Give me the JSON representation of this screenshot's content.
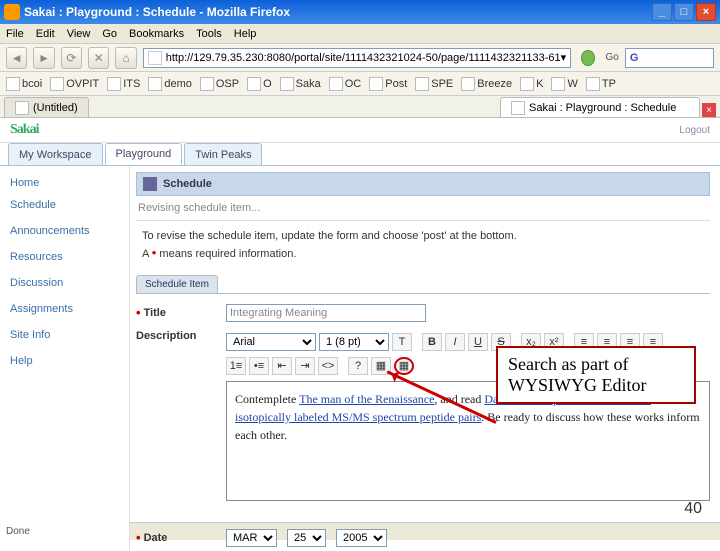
{
  "window": {
    "title": "Sakai : Playground : Schedule - Mozilla Firefox",
    "min": "_",
    "max": "□",
    "close": "×"
  },
  "menu": {
    "file": "File",
    "edit": "Edit",
    "view": "View",
    "go": "Go",
    "bookmarks": "Bookmarks",
    "tools": "Tools",
    "help": "Help"
  },
  "url": "http://129.79.35.230:8080/portal/site/1111432321024-50/page/1111432321133-61",
  "go_label": "Go",
  "search_engine": "G",
  "bookmarks": [
    {
      "label": "bcoi"
    },
    {
      "label": "OVPIT"
    },
    {
      "label": "ITS"
    },
    {
      "label": "demo"
    },
    {
      "label": "OSP"
    },
    {
      "label": "O"
    },
    {
      "label": "Saka"
    },
    {
      "label": "OC"
    },
    {
      "label": "Post"
    },
    {
      "label": "SPE"
    },
    {
      "label": "Breeze"
    },
    {
      "label": "K"
    },
    {
      "label": "W"
    },
    {
      "label": "TP"
    }
  ],
  "tabs": [
    {
      "label": "(Untitled)"
    },
    {
      "label": "Sakai : Playground : Schedule",
      "active": true
    }
  ],
  "site_logo": "Sakai",
  "logout": "Logout",
  "workspace_tabs": [
    {
      "label": "My Workspace"
    },
    {
      "label": "Playground",
      "active": true
    },
    {
      "label": "Twin Peaks"
    }
  ],
  "sidebar": [
    {
      "label": "Home"
    },
    {
      "label": "Schedule"
    },
    {
      "label": "Announcements"
    },
    {
      "label": "Resources"
    },
    {
      "label": "Discussion"
    },
    {
      "label": "Assignments"
    },
    {
      "label": "Site Info"
    },
    {
      "label": "Help"
    }
  ],
  "tool": {
    "title": "Schedule",
    "subtitle": "Revising schedule item...",
    "instruction": "To revise the schedule item, update the form and choose 'post' at the bottom.",
    "required_note": "means required information.",
    "tabs": [
      {
        "label": "Schedule Item"
      }
    ],
    "title_label": "Title",
    "title_value": "Integrating Meaning",
    "desc_label": "Description",
    "font_family": "Arial",
    "font_size": "1 (8 pt)",
    "body_prefix": "Contemplete ",
    "body_link1": "The man of the Renaissance",
    "body_mid": ", and read ",
    "body_link2": "Database-independent detection of isotopically labeled MS/MS spectrum peptide pairs",
    "body_suffix": ". Be ready to discuss how these works inform each other.",
    "date_label": "Date",
    "month": "MAR",
    "day": "25",
    "year": "2005"
  },
  "callout": {
    "line1": "Search as part of",
    "line2": "WYSIWYG Editor"
  },
  "slide_num": "40",
  "status": "Done",
  "icons": {
    "bold": "B",
    "italic": "I",
    "underline": "U",
    "strike": "S",
    "sub": "x₂",
    "sup": "x²",
    "align_l": "≡",
    "align_c": "≡",
    "align_r": "≡",
    "align_j": "≡",
    "list_ul": "•≡",
    "list_ol": "1≡",
    "outdent": "⇤",
    "indent": "⇥",
    "hr": "—",
    "link": "⧉",
    "help": "?",
    "table": "▦",
    "search": "▦"
  }
}
